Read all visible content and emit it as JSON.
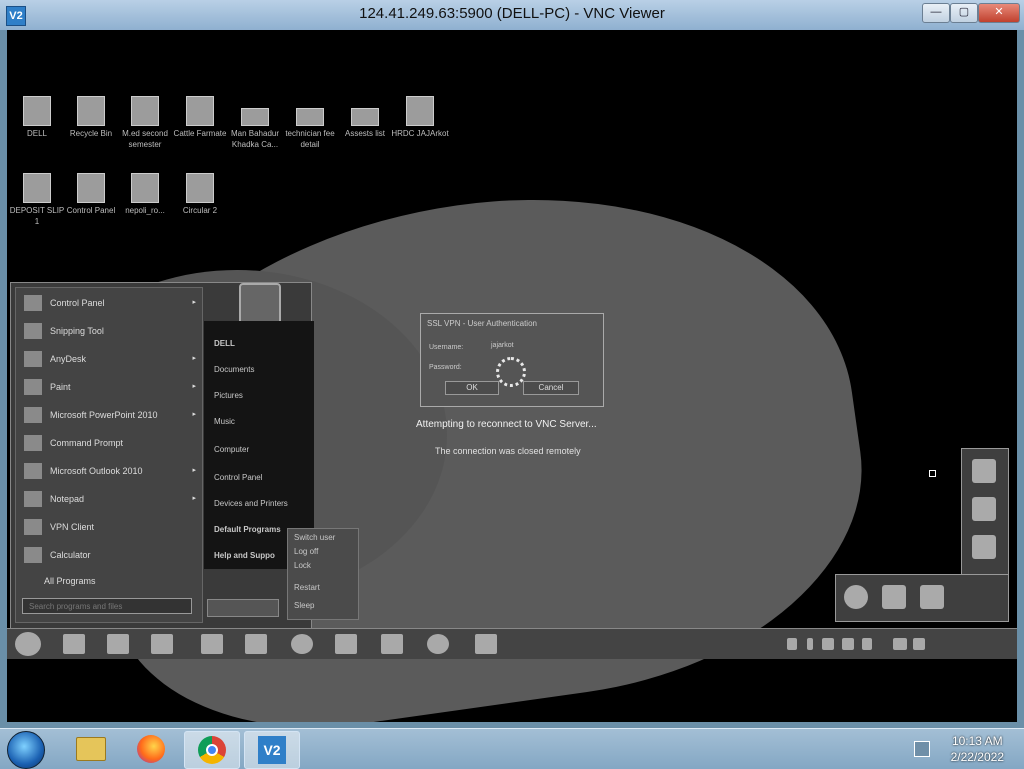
{
  "window": {
    "title": "124.41.249.63:5900 (DELL-PC) - VNC Viewer",
    "app_icon": "vnc-icon",
    "controls": {
      "minimize": "—",
      "maximize": "▢",
      "close": "✕"
    }
  },
  "remote": {
    "desktop_icons": [
      {
        "label": "DELL"
      },
      {
        "label": "Recycle Bin"
      },
      {
        "label": "M.ed second semester"
      },
      {
        "label": "Cattle Farmate"
      },
      {
        "label": "Man Bahadur Khadka Ca..."
      },
      {
        "label": "technician fee detail"
      },
      {
        "label": "Assests list"
      },
      {
        "label": "HRDC JAJArkot"
      },
      {
        "label": "DEPOSIT SLIP 1"
      },
      {
        "label": "Control Panel"
      },
      {
        "label": "nepoli_ro..."
      },
      {
        "label": "Circular 2"
      }
    ],
    "start_menu": {
      "left_items": [
        {
          "label": "Control Panel",
          "arrow": "▸"
        },
        {
          "label": "Snipping Tool",
          "arrow": ""
        },
        {
          "label": "AnyDesk",
          "arrow": "▸"
        },
        {
          "label": "Paint",
          "arrow": "▸"
        },
        {
          "label": "Microsoft PowerPoint 2010",
          "arrow": "▸"
        },
        {
          "label": "Command Prompt",
          "arrow": ""
        },
        {
          "label": "Microsoft Outlook 2010",
          "arrow": "▸"
        },
        {
          "label": "Notepad",
          "arrow": "▸"
        },
        {
          "label": "VPN Client",
          "arrow": ""
        },
        {
          "label": "Calculator",
          "arrow": ""
        }
      ],
      "all_programs": "All Programs",
      "search_placeholder": "Search programs and files",
      "right_items": [
        "DELL",
        "Documents",
        "Pictures",
        "Music",
        "Computer",
        "Control Panel",
        "Devices and Printers",
        "Default Programs",
        "Help and Suppo"
      ],
      "power_menu": [
        "Switch user",
        "Log off",
        "Lock",
        "Restart",
        "Sleep"
      ]
    },
    "ssl_dialog": {
      "title": "SSL VPN - User Authentication",
      "username_label": "Username:",
      "username_value": "jajarkot",
      "password_label": "Password:",
      "ok": "OK",
      "cancel": "Cancel"
    },
    "status": {
      "reconnecting": "Attempting to reconnect to VNC Server...",
      "closed": "The connection was closed remotely"
    }
  },
  "taskbar": {
    "time": "10:13 AM",
    "date": "2/22/2022",
    "pinned": [
      "file-explorer",
      "firefox",
      "chrome",
      "vnc-viewer"
    ]
  }
}
